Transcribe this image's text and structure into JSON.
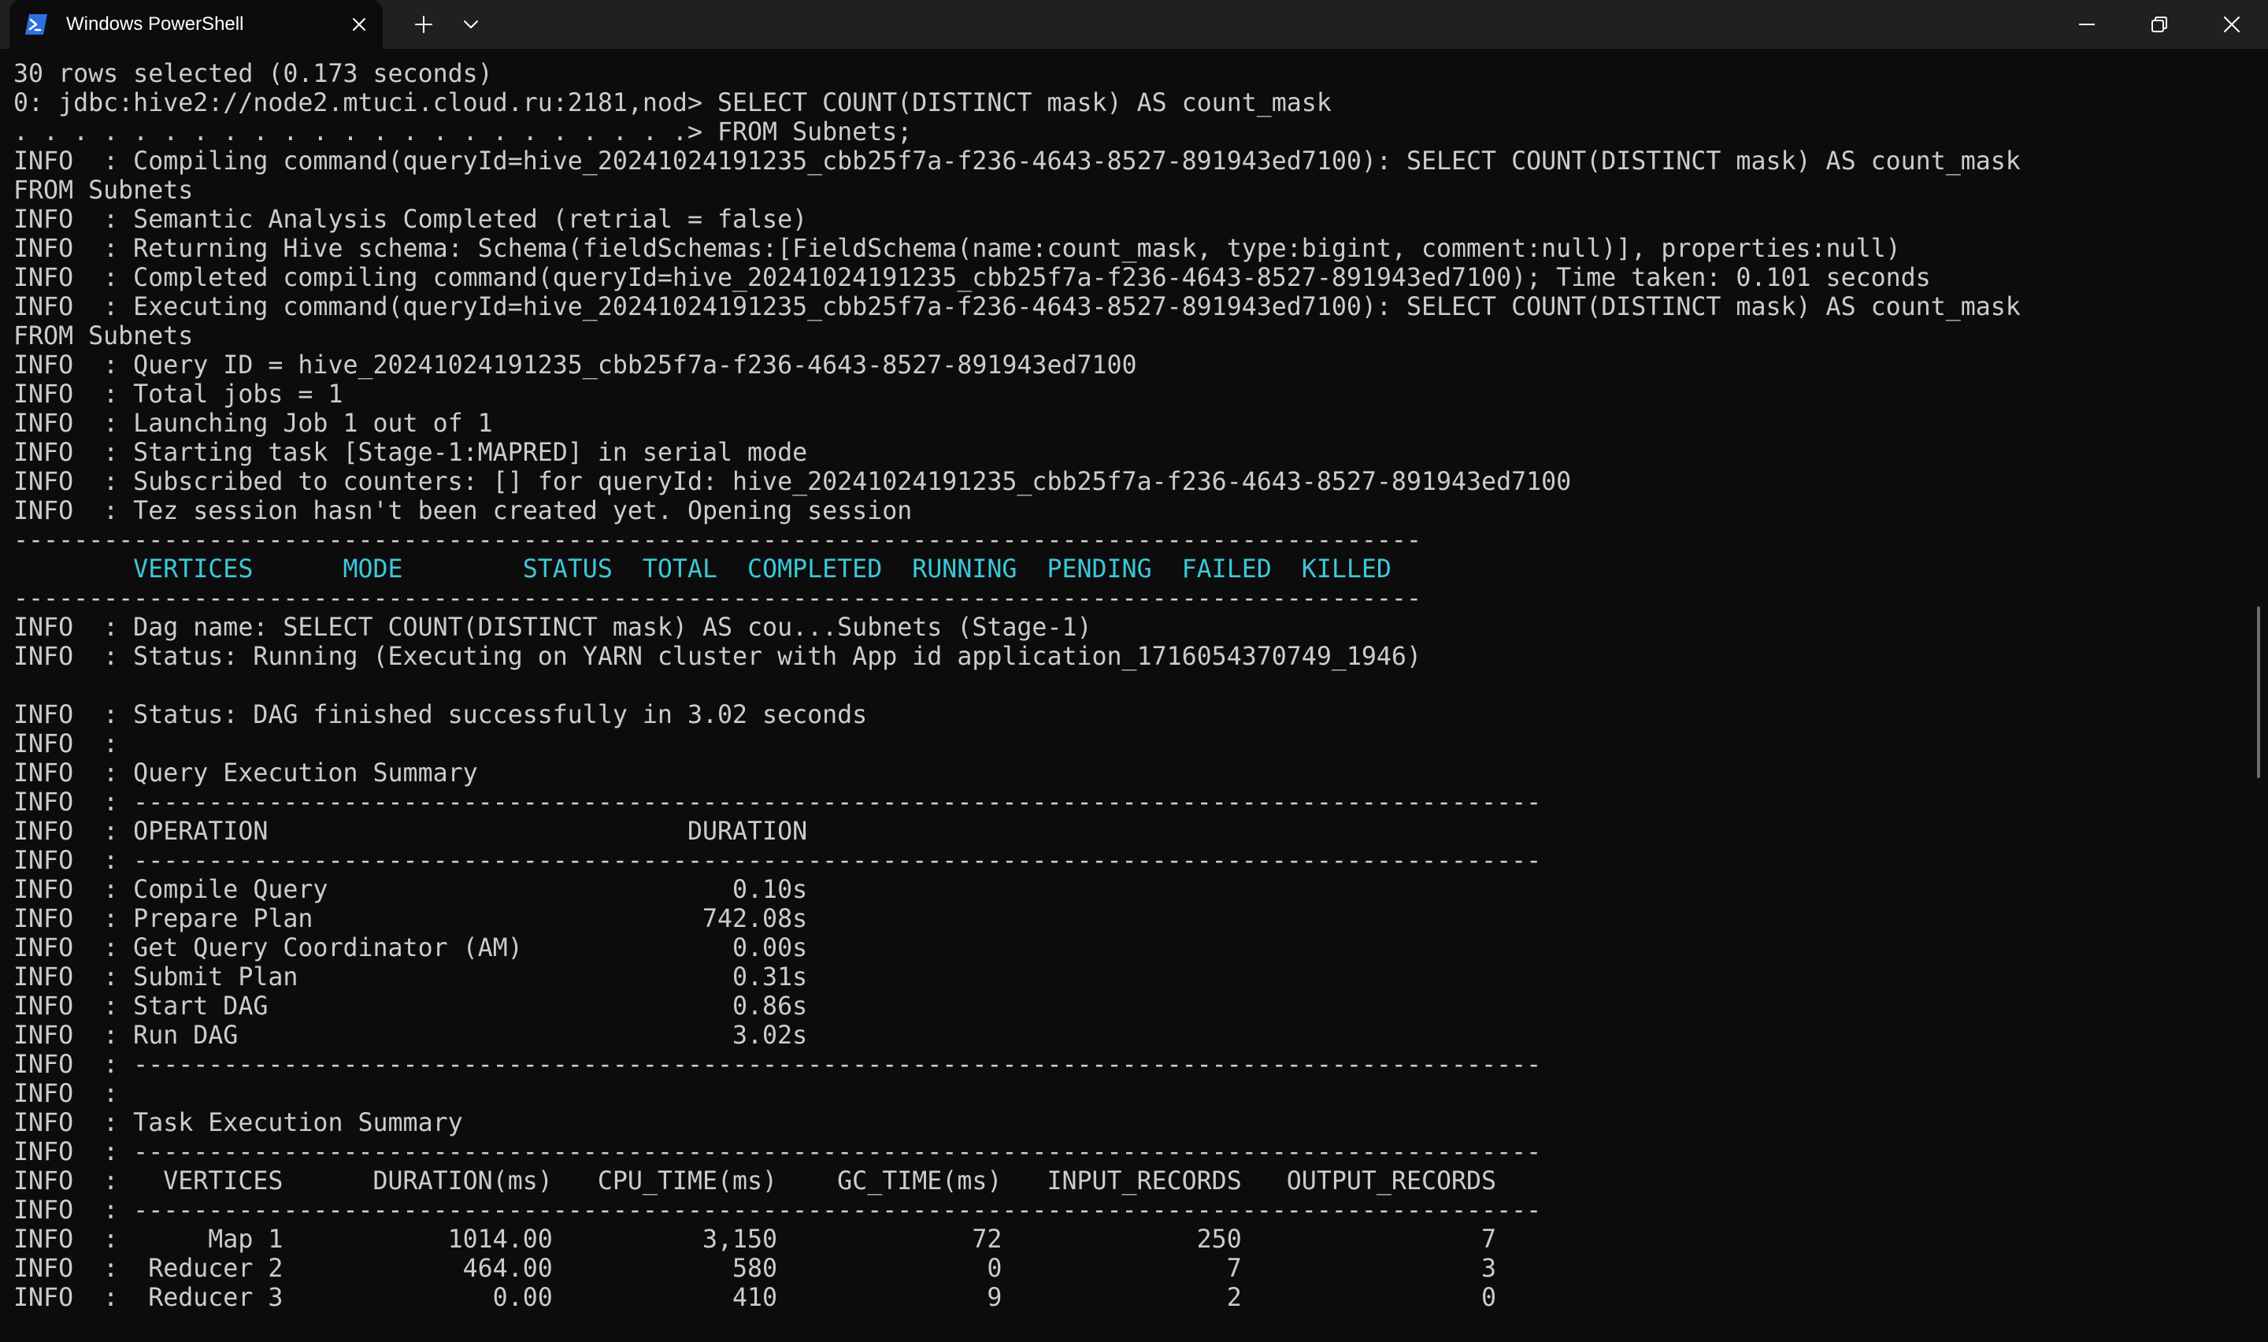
{
  "window": {
    "tab_title": "Windows PowerShell",
    "tab_icon": "powershell-icon",
    "buttons": {
      "tab_close": "close-icon",
      "new_tab": "plus-icon",
      "dropdown": "chevron-down-icon",
      "minimize": "minimize-icon",
      "restore": "restore-icon",
      "close": "close-icon"
    }
  },
  "colors": {
    "background": "#0c0c0c",
    "titlebar": "#202020",
    "text": "#cccccc",
    "header_accent": "#3bc8d8",
    "powershell_blue": "#2f6fe0"
  },
  "console": {
    "lines": [
      "30 rows selected (0.173 seconds)",
      "0: jdbc:hive2://node2.mtuci.cloud.ru:2181,nod> SELECT COUNT(DISTINCT mask) AS count_mask",
      ". . . . . . . . . . . . . . . . . . . . . . .> FROM Subnets;",
      "INFO  : Compiling command(queryId=hive_20241024191235_cbb25f7a-f236-4643-8527-891943ed7100): SELECT COUNT(DISTINCT mask) AS count_mask",
      "FROM Subnets",
      "INFO  : Semantic Analysis Completed (retrial = false)",
      "INFO  : Returning Hive schema: Schema(fieldSchemas:[FieldSchema(name:count_mask, type:bigint, comment:null)], properties:null)",
      "INFO  : Completed compiling command(queryId=hive_20241024191235_cbb25f7a-f236-4643-8527-891943ed7100); Time taken: 0.101 seconds",
      "INFO  : Executing command(queryId=hive_20241024191235_cbb25f7a-f236-4643-8527-891943ed7100): SELECT COUNT(DISTINCT mask) AS count_mask",
      "FROM Subnets",
      "INFO  : Query ID = hive_20241024191235_cbb25f7a-f236-4643-8527-891943ed7100",
      "INFO  : Total jobs = 1",
      "INFO  : Launching Job 1 out of 1",
      "INFO  : Starting task [Stage-1:MAPRED] in serial mode",
      "INFO  : Subscribed to counters: [] for queryId: hive_20241024191235_cbb25f7a-f236-4643-8527-891943ed7100",
      "INFO  : Tez session hasn't been created yet. Opening session",
      "----------------------------------------------------------------------------------------------",
      "        VERTICES      MODE        STATUS  TOTAL  COMPLETED  RUNNING  PENDING  FAILED  KILLED",
      "----------------------------------------------------------------------------------------------",
      "INFO  : Dag name: SELECT COUNT(DISTINCT mask) AS cou...Subnets (Stage-1)",
      "INFO  : Status: Running (Executing on YARN cluster with App id application_1716054370749_1946)",
      "",
      "INFO  : Status: DAG finished successfully in 3.02 seconds",
      "INFO  :",
      "INFO  : Query Execution Summary",
      "INFO  : ----------------------------------------------------------------------------------------------",
      "INFO  : OPERATION                            DURATION",
      "INFO  : ----------------------------------------------------------------------------------------------",
      "INFO  : Compile Query                           0.10s",
      "INFO  : Prepare Plan                          742.08s",
      "INFO  : Get Query Coordinator (AM)              0.00s",
      "INFO  : Submit Plan                             0.31s",
      "INFO  : Start DAG                               0.86s",
      "INFO  : Run DAG                                 3.02s",
      "INFO  : ----------------------------------------------------------------------------------------------",
      "INFO  :",
      "INFO  : Task Execution Summary",
      "INFO  : ----------------------------------------------------------------------------------------------",
      "INFO  :   VERTICES      DURATION(ms)   CPU_TIME(ms)    GC_TIME(ms)   INPUT_RECORDS   OUTPUT_RECORDS",
      "INFO  : ----------------------------------------------------------------------------------------------",
      "INFO  :      Map 1           1014.00          3,150             72             250                7",
      "INFO  :  Reducer 2            464.00            580              0               7                3",
      "INFO  :  Reducer 3              0.00            410              9               2                0"
    ],
    "header_line_index": 17
  }
}
